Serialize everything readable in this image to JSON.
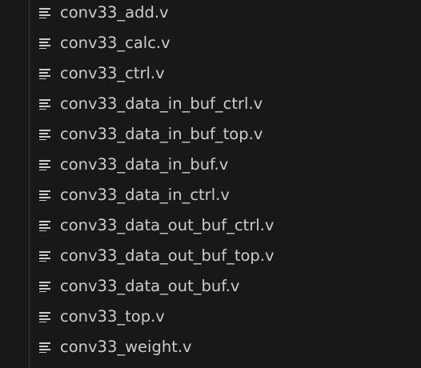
{
  "explorer": {
    "files": [
      {
        "name": "conv33_add.v",
        "icon": "text-file-icon"
      },
      {
        "name": "conv33_calc.v",
        "icon": "text-file-icon"
      },
      {
        "name": "conv33_ctrl.v",
        "icon": "text-file-icon"
      },
      {
        "name": "conv33_data_in_buf_ctrl.v",
        "icon": "text-file-icon"
      },
      {
        "name": "conv33_data_in_buf_top.v",
        "icon": "text-file-icon"
      },
      {
        "name": "conv33_data_in_buf.v",
        "icon": "text-file-icon"
      },
      {
        "name": "conv33_data_in_ctrl.v",
        "icon": "text-file-icon"
      },
      {
        "name": "conv33_data_out_buf_ctrl.v",
        "icon": "text-file-icon"
      },
      {
        "name": "conv33_data_out_buf_top.v",
        "icon": "text-file-icon"
      },
      {
        "name": "conv33_data_out_buf.v",
        "icon": "text-file-icon"
      },
      {
        "name": "conv33_top.v",
        "icon": "text-file-icon"
      },
      {
        "name": "conv33_weight.v",
        "icon": "text-file-icon"
      }
    ]
  },
  "colors": {
    "background": "#181818",
    "text": "#cccccc",
    "icon": "#cccccc",
    "indent_guide": "#3b3b3b"
  }
}
